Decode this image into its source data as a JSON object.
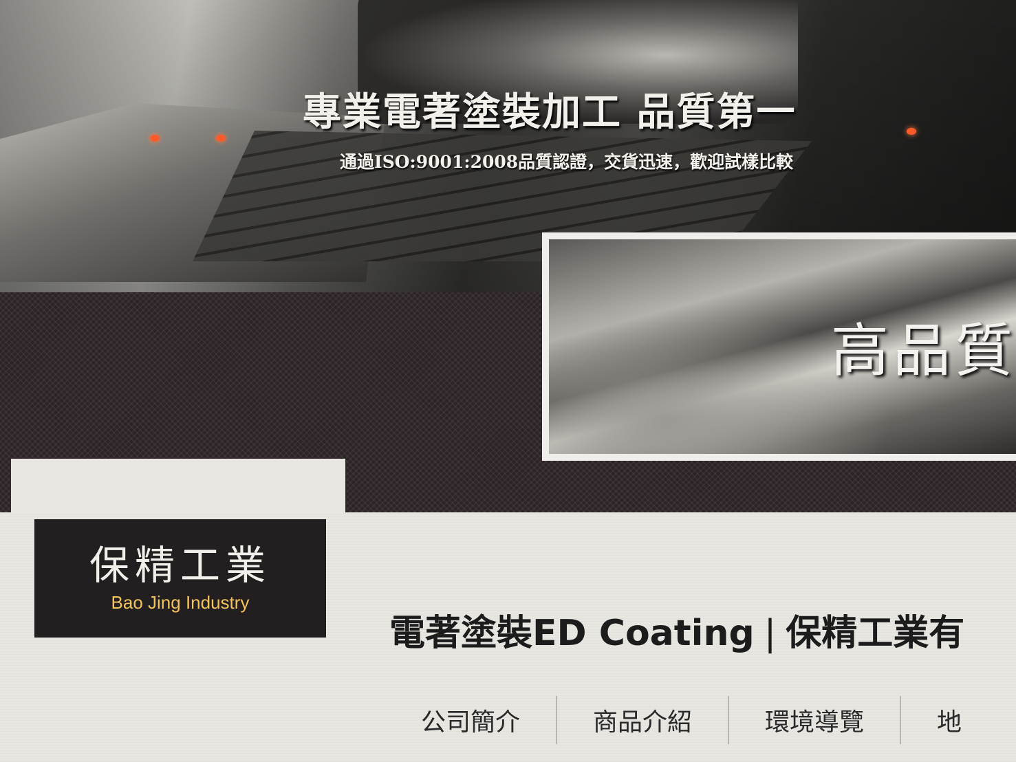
{
  "hero": {
    "title": "專業電著塗裝加工 品質第一",
    "subtitle": "通過ISO:9001:2008品質認證，交貨迅速，歡迎試樣比較"
  },
  "inset": {
    "text": "高品質"
  },
  "logo": {
    "name_cn": "保精工業",
    "name_en": "Bao Jing Industry",
    "accent_color": "#f3c45a"
  },
  "site_title": {
    "main": "電著塗裝ED Coating",
    "separator": "|",
    "company": "保精工業有"
  },
  "nav": {
    "items": [
      {
        "label": "公司簡介"
      },
      {
        "label": "商品介紹"
      },
      {
        "label": "環境導覽"
      },
      {
        "label": "地"
      }
    ]
  }
}
